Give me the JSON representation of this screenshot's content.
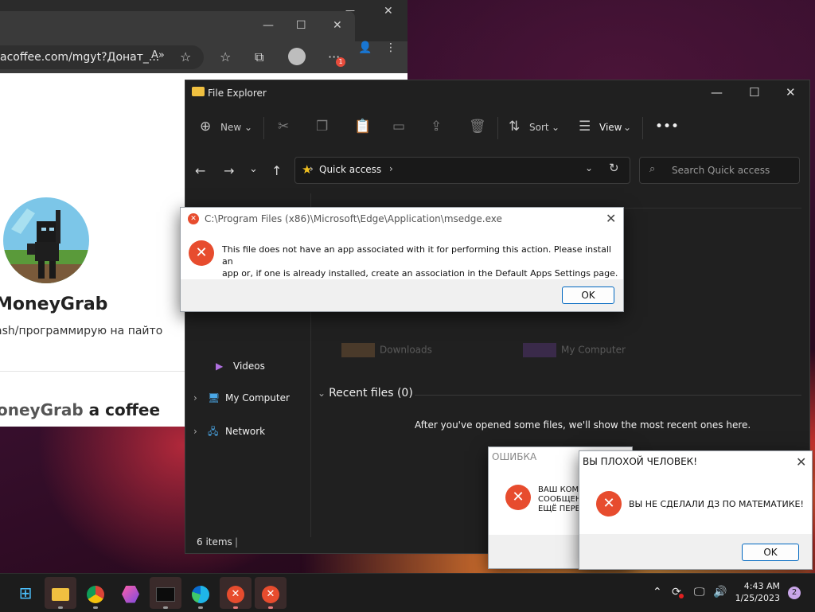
{
  "browser": {
    "url": "acoffee.com/mgyt?Донат_...",
    "notification_count": "1",
    "creator_name": "MoneyGrab",
    "creator_desc": "ash/программирую на пайто",
    "buy_prefix": "oneyGrab",
    "buy_suffix": "a coffee"
  },
  "explorer": {
    "title": "File Explorer",
    "toolbar": {
      "new_label": "New",
      "sort_label": "Sort",
      "view_label": "View"
    },
    "address": "Quick access",
    "search_placeholder": "Search Quick access",
    "nav": {
      "videos": "Videos",
      "my_computer": "My Computer",
      "network": "Network"
    },
    "ghost_items": [
      "Downloads",
      "My Computer"
    ],
    "recent_header": "Recent files (0)",
    "empty_message": "After you've opened some files, we'll show the most recent ones here.",
    "status": "6 items"
  },
  "error_dialog": {
    "title": "C:\\Program Files (x86)\\Microsoft\\Edge\\Application\\msedge.exe",
    "message_line1": "This file does not have an app associated with it for performing this action. Please install an",
    "message_line2": "app or, if one is already installed, create an association in the Default Apps Settings page.",
    "ok_label": "OK"
  },
  "dialog_oshibka": {
    "title": "ОШИБКА",
    "line1": "ВАШ КОМ",
    "line2": "СООБЩЕН",
    "line3": "ЕЩЁ ПЕРЕ"
  },
  "dialog_bad_person": {
    "title": "ВЫ ПЛОХОЙ ЧЕЛОВЕК!",
    "message": "ВЫ НЕ СДЕЛАЛИ ДЗ ПО МАТЕМАТИКЕ!",
    "ok_label": "OK"
  },
  "taskbar": {
    "apps": [
      "start",
      "file-explorer",
      "chrome",
      "app-purple",
      "terminal",
      "edge",
      "error-app-1",
      "error-app-2"
    ],
    "time": "4:43 AM",
    "date": "1/25/2023",
    "notification_count": "2"
  },
  "colors": {
    "accent": "#0067c0",
    "error_red": "#e74c2e",
    "explorer_bg": "#202020",
    "star_yellow": "#f0c020"
  }
}
